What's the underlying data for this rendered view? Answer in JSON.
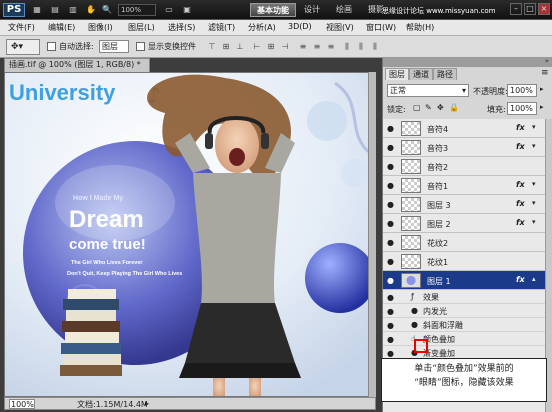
{
  "titlebar": {
    "logo": "PS",
    "zoom": "100%",
    "workspace_buttons": [
      "基本功能",
      "设计",
      "绘画",
      "摄影"
    ],
    "watermark": "思缘设计论坛 www.missyuan.com"
  },
  "menubar": {
    "items": [
      "文件(F)",
      "编辑(E)",
      "图像(I)",
      "图层(L)",
      "选择(S)",
      "滤镜(T)",
      "分析(A)",
      "3D(D)",
      "视图(V)",
      "窗口(W)",
      "帮助(H)"
    ]
  },
  "options": {
    "auto_select_label": "自动选择:",
    "auto_select_value": "图层",
    "show_transform_label": "显示变换控件"
  },
  "document": {
    "tab_title": "插画.tif @ 100% (图层 1, RGB/8) *",
    "zoom": "100%",
    "doc_size": "文档:1.15M/14.4M",
    "art": {
      "university": "University",
      "small_text_1": "How I Made My",
      "dream": "Dream",
      "come_true": "come true!",
      "line_1": "The Girl Who Lives Forever",
      "line_2": "Don't Quit, Keep Playing The Girl Who Lives"
    }
  },
  "layers_panel": {
    "tabs": [
      "图层",
      "通道",
      "路径"
    ],
    "blend_mode": "正常",
    "opacity_label": "不透明度:",
    "opacity": "100%",
    "lock_label": "锁定:",
    "fill_label": "填充:",
    "fill": "100%",
    "layers": [
      {
        "name": "音符4",
        "fx": true
      },
      {
        "name": "音符3",
        "fx": true
      },
      {
        "name": "音符2",
        "fx": false
      },
      {
        "name": "音符1",
        "fx": true
      },
      {
        "name": "图层 3",
        "fx": true
      },
      {
        "name": "图层 2",
        "fx": true
      },
      {
        "name": "花纹2",
        "fx": false
      },
      {
        "name": "花纹1",
        "fx": false
      },
      {
        "name": "图层 1",
        "fx": true,
        "selected": true
      }
    ],
    "effects_label": "效果",
    "effects": [
      "内发光",
      "斜面和浮雕",
      "颜色叠加",
      "渐变叠加"
    ],
    "fx_label": "fx"
  },
  "callout": {
    "line1": "单击“颜色叠加”效果前的",
    "line2": "“眼睛”图标，隐藏该效果"
  },
  "colors": {
    "selected_layer": "#1c3a8a",
    "highlight": "#e00000"
  }
}
